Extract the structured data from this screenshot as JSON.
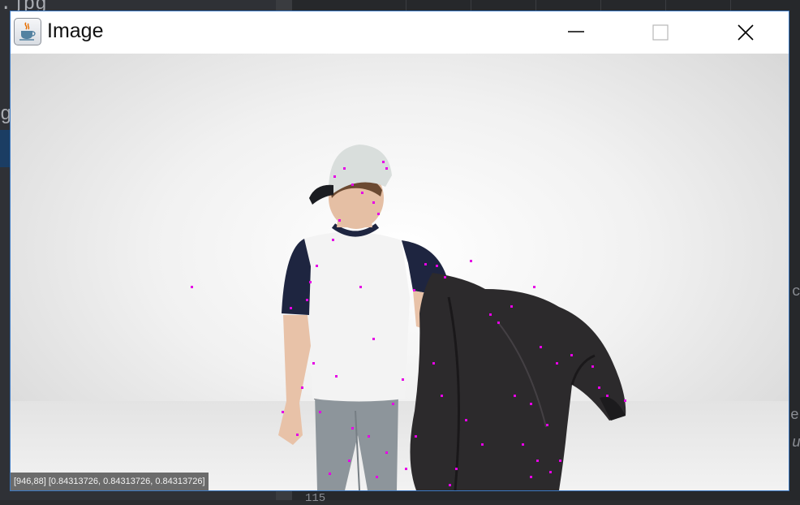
{
  "window": {
    "title": "Image",
    "icon": "java-cup-icon",
    "controls": [
      "minimize",
      "maximize",
      "close"
    ]
  },
  "background_fragments": {
    "top_left": ".jpg",
    "left_edge": "g",
    "right_edge_1": "c",
    "right_edge_2": "ep",
    "right_edge_3": "u",
    "bottom_center": "115"
  },
  "image": {
    "subject": "person in white cap and raglan t-shirt holding a black leather jacket",
    "keypoint_color": "#e600e6"
  },
  "status": {
    "coords": "[946,88]",
    "pixel_value": "[0.84313726, 0.84313726, 0.84313726]"
  }
}
